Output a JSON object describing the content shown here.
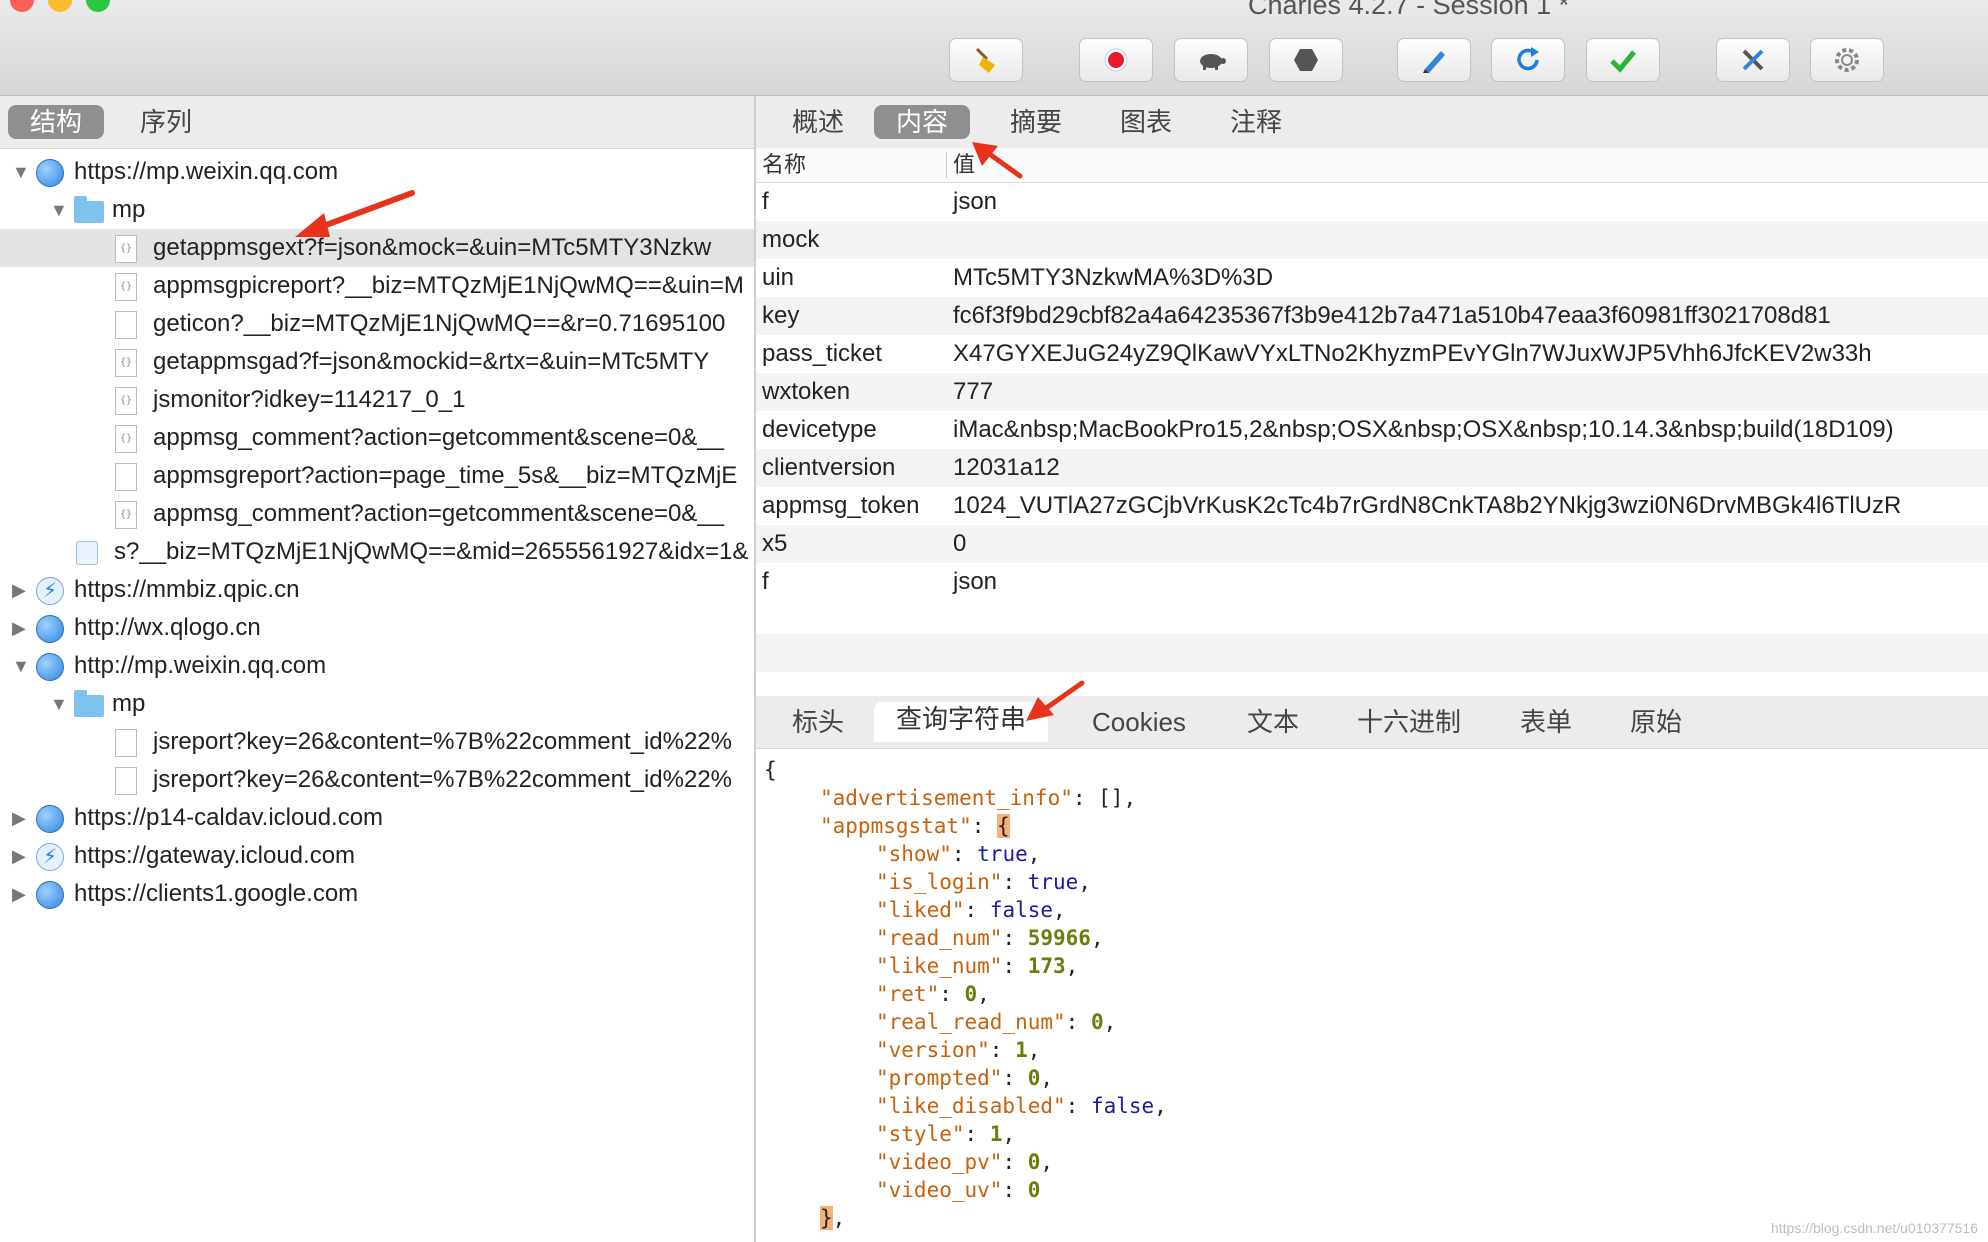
{
  "window": {
    "title": "Charles 4.2.7 - Session 1 *"
  },
  "toolbar": {
    "buttons": [
      {
        "name": "broom-icon"
      },
      {
        "name": "record-icon"
      },
      {
        "name": "turtle-icon"
      },
      {
        "name": "stop-hexagon-icon"
      },
      {
        "name": "pen-icon"
      },
      {
        "name": "refresh-icon"
      },
      {
        "name": "checkmark-icon"
      },
      {
        "name": "tools-icon"
      },
      {
        "name": "gear-icon"
      }
    ]
  },
  "left": {
    "tabs": [
      "结构",
      "序列"
    ],
    "active_tab": "结构",
    "tree": [
      {
        "label": "https://mp.weixin.qq.com",
        "icon": "globe-icon",
        "expanded": true
      },
      {
        "label": "mp",
        "icon": "folder-icon",
        "expanded": true
      },
      {
        "label": "getappmsgext?f=json&mock=&uin=MTc5MTY3Nzkw",
        "icon": "json-doc-icon",
        "selected": true
      },
      {
        "label": "appmsgpicreport?__biz=MTQzMjE1NjQwMQ==&uin=M",
        "icon": "json-doc-icon"
      },
      {
        "label": "geticon?__biz=MTQzMjE1NjQwMQ==&r=0.71695100",
        "icon": "doc-icon"
      },
      {
        "label": "getappmsgad?f=json&mockid=&rtx=&uin=MTc5MTY",
        "icon": "json-doc-icon"
      },
      {
        "label": "jsmonitor?idkey=114217_0_1",
        "icon": "json-doc-icon"
      },
      {
        "label": "appmsg_comment?action=getcomment&scene=0&__",
        "icon": "json-doc-icon"
      },
      {
        "label": "appmsgreport?action=page_time_5s&__biz=MTQzMjE",
        "icon": "doc-icon"
      },
      {
        "label": "appmsg_comment?action=getcomment&scene=0&__",
        "icon": "json-doc-icon"
      },
      {
        "label": "s?__biz=MTQzMjE1NjQwMQ==&mid=2655561927&idx=1&",
        "icon": "page-icon"
      },
      {
        "label": "https://mmbiz.qpic.cn",
        "icon": "bolt-icon",
        "expanded": false
      },
      {
        "label": "http://wx.qlogo.cn",
        "icon": "globe-icon",
        "expanded": false
      },
      {
        "label": "http://mp.weixin.qq.com",
        "icon": "globe-icon",
        "expanded": true
      },
      {
        "label": "mp",
        "icon": "folder-icon",
        "expanded": true
      },
      {
        "label": "jsreport?key=26&content=%7B%22comment_id%22%",
        "icon": "doc-icon"
      },
      {
        "label": "jsreport?key=26&content=%7B%22comment_id%22%",
        "icon": "doc-icon"
      },
      {
        "label": "https://p14-caldav.icloud.com",
        "icon": "globe-icon",
        "expanded": false
      },
      {
        "label": "https://gateway.icloud.com",
        "icon": "bolt-icon",
        "expanded": false
      },
      {
        "label": "https://clients1.google.com",
        "icon": "globe-icon",
        "expanded": false
      }
    ]
  },
  "right": {
    "top_tabs": [
      "概述",
      "内容",
      "摘要",
      "图表",
      "注释"
    ],
    "top_active": "内容",
    "kv_header": {
      "name": "名称",
      "value": "值"
    },
    "kv_rows": [
      {
        "name": "f",
        "value": "json"
      },
      {
        "name": "mock",
        "value": ""
      },
      {
        "name": "uin",
        "value": "MTc5MTY3NzkwMA%3D%3D"
      },
      {
        "name": "key",
        "value": "fc6f3f9bd29cbf82a4a64235367f3b9e412b7a471a510b47eaa3f60981ff3021708d81"
      },
      {
        "name": "pass_ticket",
        "value": "X47GYXEJuG24yZ9QlKawVYxLTNo2KhyzmPEvYGln7WJuxWJP5Vhh6JfcKEV2w33h"
      },
      {
        "name": "wxtoken",
        "value": "777"
      },
      {
        "name": "devicetype",
        "value": "iMac&nbsp;MacBookPro15,2&nbsp;OSX&nbsp;OSX&nbsp;10.14.3&nbsp;build(18D109)"
      },
      {
        "name": "clientversion",
        "value": "12031a12"
      },
      {
        "name": "appmsg_token",
        "value": "1024_VUTlA27zGCjbVrKusK2cTc4b7rGrdN8CnkTA8b2YNkjg3wzi0N6DrvMBGk4l6TlUzR"
      },
      {
        "name": "x5",
        "value": "0"
      },
      {
        "name": "f",
        "value": "json"
      }
    ],
    "bottom_tabs": [
      "标头",
      "查询字符串",
      "Cookies",
      "文本",
      "十六进制",
      "表单",
      "原始"
    ],
    "bottom_active": "查询字符串",
    "json_lines": [
      {
        "indent": 0,
        "parts": [
          {
            "t": "p",
            "v": "{"
          }
        ]
      },
      {
        "indent": 1,
        "parts": [
          {
            "t": "k",
            "v": "\"advertisement_info\""
          },
          {
            "t": "p",
            "v": ": [],"
          }
        ]
      },
      {
        "indent": 1,
        "parts": [
          {
            "t": "k",
            "v": "\"appmsgstat\""
          },
          {
            "t": "p",
            "v": ": "
          },
          {
            "t": "hl",
            "v": "{"
          }
        ]
      },
      {
        "indent": 2,
        "parts": [
          {
            "t": "k",
            "v": "\"show\""
          },
          {
            "t": "p",
            "v": ": "
          },
          {
            "t": "b",
            "v": "true"
          },
          {
            "t": "p",
            "v": ","
          }
        ]
      },
      {
        "indent": 2,
        "parts": [
          {
            "t": "k",
            "v": "\"is_login\""
          },
          {
            "t": "p",
            "v": ": "
          },
          {
            "t": "b",
            "v": "true"
          },
          {
            "t": "p",
            "v": ","
          }
        ]
      },
      {
        "indent": 2,
        "parts": [
          {
            "t": "k",
            "v": "\"liked\""
          },
          {
            "t": "p",
            "v": ": "
          },
          {
            "t": "b",
            "v": "false"
          },
          {
            "t": "p",
            "v": ","
          }
        ]
      },
      {
        "indent": 2,
        "parts": [
          {
            "t": "k",
            "v": "\"read_num\""
          },
          {
            "t": "p",
            "v": ": "
          },
          {
            "t": "n",
            "v": "59966"
          },
          {
            "t": "p",
            "v": ","
          }
        ]
      },
      {
        "indent": 2,
        "parts": [
          {
            "t": "k",
            "v": "\"like_num\""
          },
          {
            "t": "p",
            "v": ": "
          },
          {
            "t": "n",
            "v": "173"
          },
          {
            "t": "p",
            "v": ","
          }
        ]
      },
      {
        "indent": 2,
        "parts": [
          {
            "t": "k",
            "v": "\"ret\""
          },
          {
            "t": "p",
            "v": ": "
          },
          {
            "t": "n",
            "v": "0"
          },
          {
            "t": "p",
            "v": ","
          }
        ]
      },
      {
        "indent": 2,
        "parts": [
          {
            "t": "k",
            "v": "\"real_read_num\""
          },
          {
            "t": "p",
            "v": ": "
          },
          {
            "t": "n",
            "v": "0"
          },
          {
            "t": "p",
            "v": ","
          }
        ]
      },
      {
        "indent": 2,
        "parts": [
          {
            "t": "k",
            "v": "\"version\""
          },
          {
            "t": "p",
            "v": ": "
          },
          {
            "t": "n",
            "v": "1"
          },
          {
            "t": "p",
            "v": ","
          }
        ]
      },
      {
        "indent": 2,
        "parts": [
          {
            "t": "k",
            "v": "\"prompted\""
          },
          {
            "t": "p",
            "v": ": "
          },
          {
            "t": "n",
            "v": "0"
          },
          {
            "t": "p",
            "v": ","
          }
        ]
      },
      {
        "indent": 2,
        "parts": [
          {
            "t": "k",
            "v": "\"like_disabled\""
          },
          {
            "t": "p",
            "v": ": "
          },
          {
            "t": "b",
            "v": "false"
          },
          {
            "t": "p",
            "v": ","
          }
        ]
      },
      {
        "indent": 2,
        "parts": [
          {
            "t": "k",
            "v": "\"style\""
          },
          {
            "t": "p",
            "v": ": "
          },
          {
            "t": "n",
            "v": "1"
          },
          {
            "t": "p",
            "v": ","
          }
        ]
      },
      {
        "indent": 2,
        "parts": [
          {
            "t": "k",
            "v": "\"video_pv\""
          },
          {
            "t": "p",
            "v": ": "
          },
          {
            "t": "n",
            "v": "0"
          },
          {
            "t": "p",
            "v": ","
          }
        ]
      },
      {
        "indent": 2,
        "parts": [
          {
            "t": "k",
            "v": "\"video_uv\""
          },
          {
            "t": "p",
            "v": ": "
          },
          {
            "t": "n",
            "v": "0"
          }
        ]
      },
      {
        "indent": 1,
        "parts": [
          {
            "t": "hl",
            "v": "}"
          },
          {
            "t": "p",
            "v": ","
          }
        ]
      }
    ]
  },
  "watermark": "https://blog.csdn.net/u010377516",
  "colors": {
    "json_key": "#c8600c",
    "json_bool": "#1a1aa6",
    "json_number": "#6b7d0a",
    "annotation_arrow": "#e8331c"
  }
}
